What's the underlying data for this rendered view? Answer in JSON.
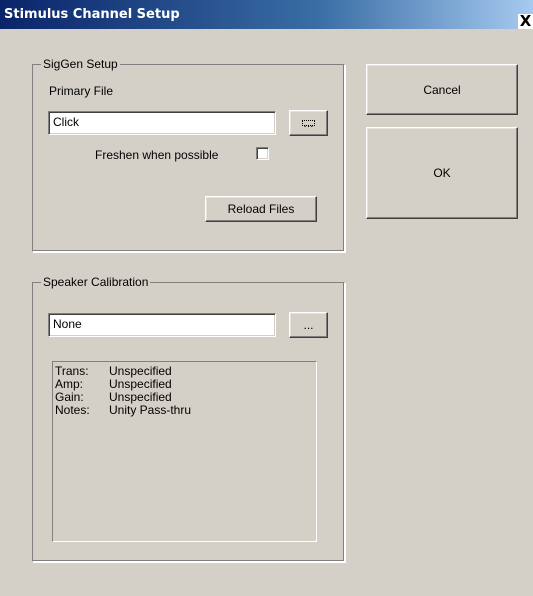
{
  "window": {
    "title": "Stimulus Channel Setup",
    "close_glyph": "X"
  },
  "siggen": {
    "group_label": "SigGen Setup",
    "primary_file_label": "Primary File",
    "primary_file_value": "Click",
    "browse_label": "...",
    "freshen_label": "Freshen when possible",
    "freshen_checked": false,
    "reload_label": "Reload Files"
  },
  "calibration": {
    "group_label": "Speaker Calibration",
    "file_value": "None",
    "browse_label": "...",
    "info": [
      {
        "key": "Trans:",
        "value": "Unspecified"
      },
      {
        "key": "Amp:",
        "value": "Unspecified"
      },
      {
        "key": "Gain:",
        "value": "Unspecified"
      },
      {
        "key": "Notes:",
        "value": "Unity Pass-thru"
      }
    ]
  },
  "actions": {
    "cancel_label": "Cancel",
    "ok_label": "OK"
  },
  "colors": {
    "dialog_bg": "#d4d0c8",
    "titlebar_start": "#0a246a",
    "titlebar_end": "#a6caf0"
  }
}
